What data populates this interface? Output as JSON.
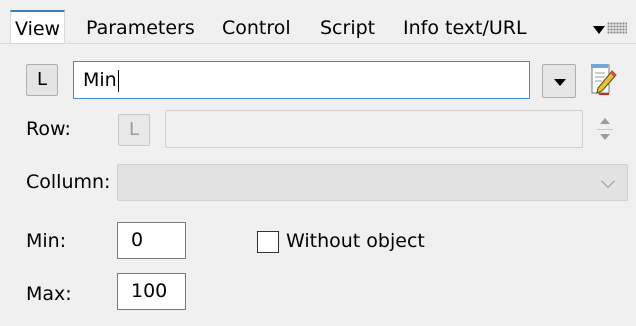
{
  "tabs": [
    {
      "label": "View",
      "active": true
    },
    {
      "label": "Parameters",
      "active": false
    },
    {
      "label": "Control",
      "active": false
    },
    {
      "label": "Script",
      "active": false
    },
    {
      "label": "Info text/URL",
      "active": false
    }
  ],
  "name_row": {
    "l_button": "L",
    "name_value": "Min",
    "dropdown_icon": "triangle-down-icon",
    "edit_icon": "edit-text-icon"
  },
  "row_field": {
    "label": "Row:",
    "l_button": "L",
    "value": "",
    "enabled": false
  },
  "column_field": {
    "label": "Collumn:",
    "value": "",
    "enabled": false
  },
  "min_field": {
    "label": "Min:",
    "value": "0"
  },
  "max_field": {
    "label": "Max:",
    "value": "100"
  },
  "without_object": {
    "label": "Without object",
    "checked": false
  },
  "colors": {
    "background": "#f0f0f0",
    "active_tab_accent": "#3c7fc1",
    "focus_border": "#3c8ad6",
    "disabled_field": "#e2e2e2"
  }
}
